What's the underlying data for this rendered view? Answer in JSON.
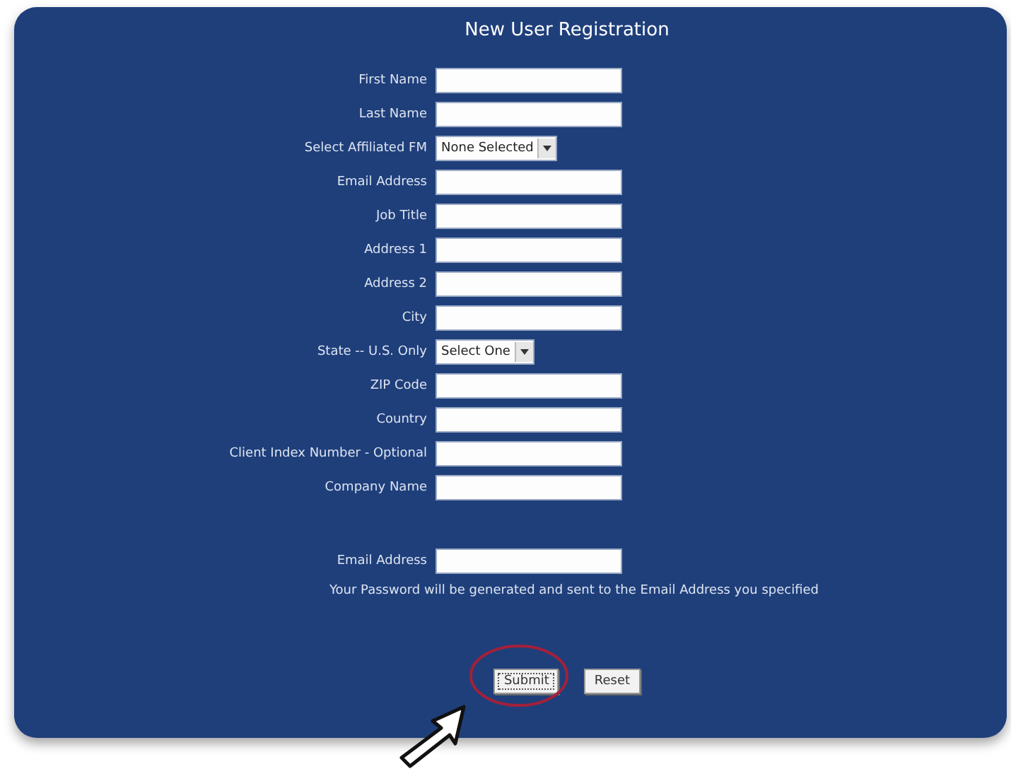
{
  "title": "New User Registration",
  "fields": [
    {
      "label": "First Name",
      "kind": "text"
    },
    {
      "label": "Last Name",
      "kind": "text"
    },
    {
      "label": "Select Affiliated FM",
      "kind": "select",
      "value": "None Selected"
    },
    {
      "label": "Email Address",
      "kind": "text"
    },
    {
      "label": "Job Title",
      "kind": "text"
    },
    {
      "label": "Address 1",
      "kind": "text"
    },
    {
      "label": "Address 2",
      "kind": "text"
    },
    {
      "label": "City",
      "kind": "text"
    },
    {
      "label": "State -- U.S. Only",
      "kind": "select",
      "value": "Select One"
    },
    {
      "label": "ZIP Code",
      "kind": "text"
    },
    {
      "label": "Country",
      "kind": "text"
    },
    {
      "label": "Client Index Number - Optional",
      "kind": "text"
    },
    {
      "label": "Company Name",
      "kind": "text"
    }
  ],
  "confirm": {
    "label": "Email Address",
    "note": "Your Password will be generated and sent to the Email Address you specified"
  },
  "buttons": [
    {
      "label": "Submit",
      "highlighted": true
    },
    {
      "label": "Reset",
      "highlighted": false
    }
  ]
}
